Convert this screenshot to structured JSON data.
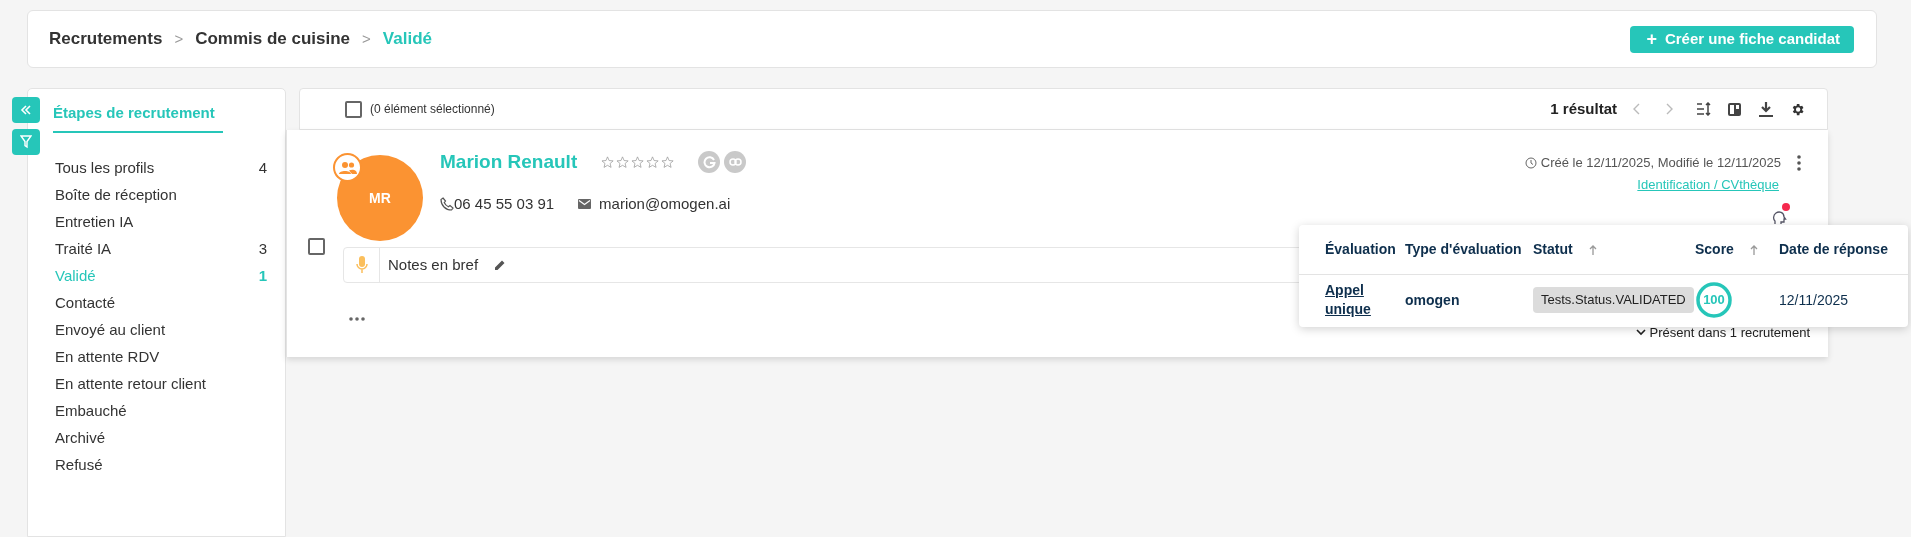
{
  "breadcrumb": [
    {
      "label": "Recrutements",
      "current": false
    },
    {
      "label": "Commis de cuisine",
      "current": false
    },
    {
      "label": "Validé",
      "current": true
    }
  ],
  "breadcrumb_separator": ">",
  "create_button": {
    "icon": "+",
    "label": "Créer une fiche candidat"
  },
  "sidebar": {
    "title": "Étapes de recrutement",
    "items": [
      {
        "label": "Tous les profils",
        "count": "4",
        "selected": false
      },
      {
        "label": "Boîte de réception",
        "selected": false
      },
      {
        "label": "Entretien IA",
        "selected": false
      },
      {
        "label": "Traité IA",
        "count": "3",
        "selected": false
      },
      {
        "label": "Validé",
        "count": "1",
        "selected": true
      },
      {
        "label": "Contacté",
        "selected": false
      },
      {
        "label": "Envoyé au client",
        "selected": false
      },
      {
        "label": "En attente RDV",
        "selected": false
      },
      {
        "label": "En attente retour client",
        "selected": false
      },
      {
        "label": "Embauché",
        "selected": false
      },
      {
        "label": "Archivé",
        "selected": false
      },
      {
        "label": "Refusé",
        "selected": false
      }
    ]
  },
  "toolbar": {
    "checked": false,
    "selection_label": "(0 élément sélectionné)",
    "result_count": "1 résultat"
  },
  "candidate": {
    "checked": false,
    "initials": "MR",
    "name": "Marion Renault",
    "stars": 0,
    "phone": "06 45 55 03 91",
    "email": "marion@omogen.ai",
    "dates": "Créé le 12/11/2025, Modifié le 12/11/2025",
    "source_link": "Identification / CVthèque",
    "notes_label": "Notes en bref",
    "recruitment_label": "Présent dans 1 recrutement",
    "unread": true
  },
  "evaluation_popup": {
    "columns": [
      {
        "label": "Évaluation"
      },
      {
        "label": "Type d'évaluation"
      },
      {
        "label": "Statut",
        "sortable": true
      },
      {
        "label": "Score",
        "sortable": true
      },
      {
        "label": "Date de réponse"
      }
    ],
    "rows": [
      {
        "evaluation": "Appel unique",
        "type": "omogen",
        "status": "Tests.Status.VALIDATED",
        "score": "100",
        "date": "12/11/2025"
      }
    ]
  }
}
